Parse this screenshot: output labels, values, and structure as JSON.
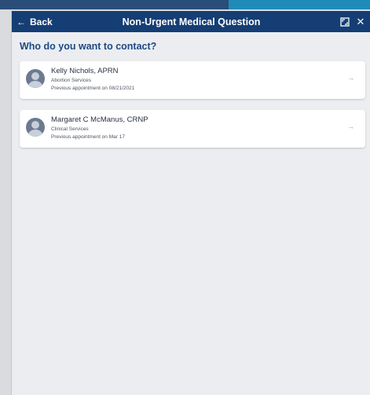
{
  "header": {
    "back_label": "Back",
    "back_icon": "←",
    "title": "Non-Urgent Medical Question",
    "close_icon": "✕"
  },
  "prompt": "Who do you want to contact?",
  "contacts": [
    {
      "name": "Kelly Nichols, APRN",
      "service": "Abortion Services",
      "appointment": "Previous appointment on 08/21/2021",
      "arrow": "→"
    },
    {
      "name": "Margaret C McManus, CRNP",
      "service": "Clinical Services",
      "appointment": "Previous appointment on Mar 17",
      "arrow": "→"
    }
  ],
  "colors": {
    "header_bg": "#153e74",
    "prompt_text": "#1c4a86",
    "panel_bg": "#ecedf0"
  }
}
